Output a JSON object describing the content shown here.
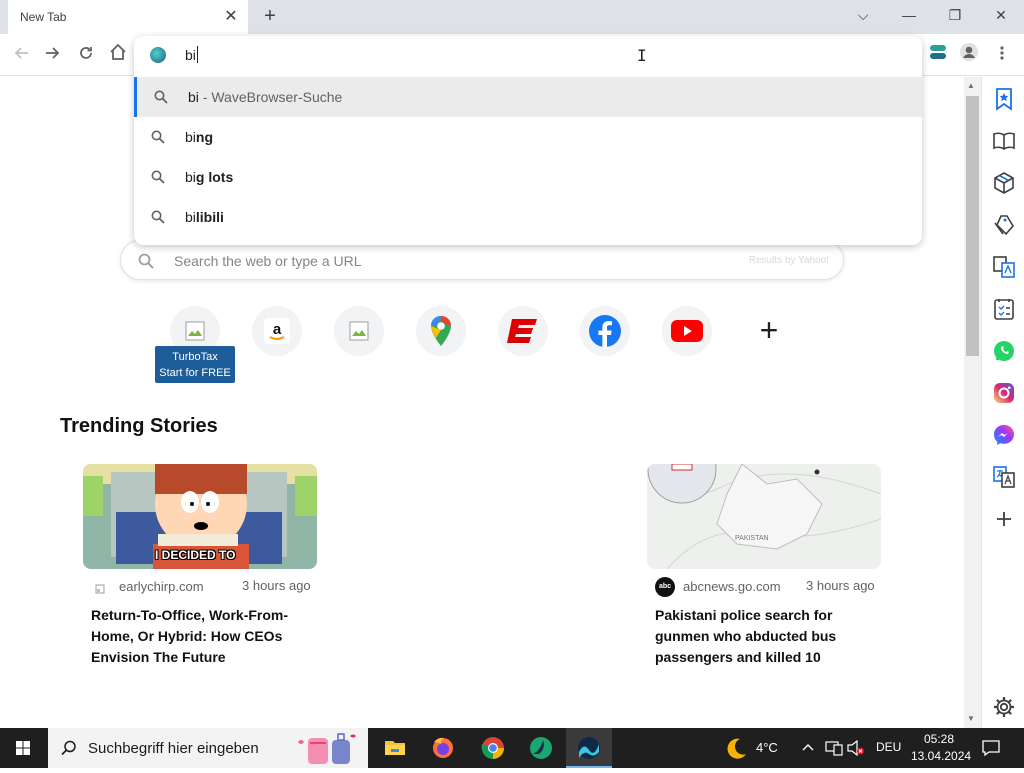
{
  "browser": {
    "tab_title": "New Tab",
    "tab_close": "✕",
    "new_tab": "+",
    "window_controls": {
      "chevron": "⌵",
      "minimize": "—",
      "restore": "❐",
      "close": "✕"
    }
  },
  "omnibox": {
    "value": "bi",
    "suggestions": [
      {
        "prefix": "bi",
        "rest": "",
        "sub": " - WaveBrowser-Suche"
      },
      {
        "prefix": "bi",
        "rest": "ng",
        "sub": ""
      },
      {
        "prefix": "bi",
        "rest": "g lots",
        "sub": ""
      },
      {
        "prefix": "bi",
        "rest": "libili",
        "sub": ""
      }
    ]
  },
  "page_search": {
    "placeholder": "Search the web or type a URL",
    "provider": "Results by Yahoo!"
  },
  "shortcuts": {
    "turbotax_line1": "TurboTax",
    "turbotax_line2": "Start for FREE",
    "add": "+"
  },
  "trending": {
    "title": "Trending Stories",
    "cards": [
      {
        "source": "earlychirp.com",
        "time": "3 hours ago",
        "title": "Return-To-Office, Work-From-Home, Or Hybrid: How CEOs Envision The Future",
        "caption": "I DECIDED TO"
      },
      {
        "source": "abcnews.go.com",
        "time": "3 hours ago",
        "title": "Pakistani police search for gunmen who abducted bus passengers and killed 10",
        "map_label": "PAKISTAN"
      }
    ]
  },
  "taskbar": {
    "search_placeholder": "Suchbegriff hier eingeben",
    "temperature": "4°C",
    "language": "DEU",
    "time": "05:28",
    "date": "13.04.2024"
  },
  "colors": {
    "accent": "#1a73e8",
    "taskbar": "#1f1f1f",
    "tooltip": "#1d5d99"
  }
}
